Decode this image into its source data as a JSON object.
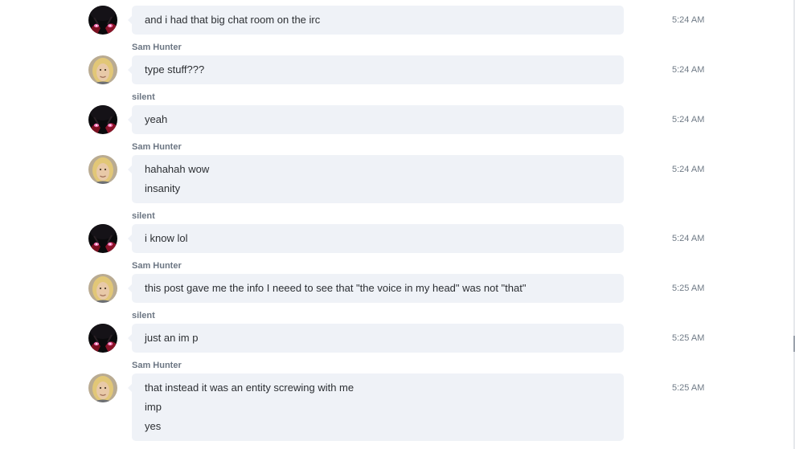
{
  "names": {
    "silent": "silent",
    "sam": "Sam Hunter"
  },
  "messages": [
    {
      "text": "and i had that big chat room on the irc",
      "time": "5:24 AM"
    },
    {
      "text": "type stuff???",
      "time": "5:24 AM"
    },
    {
      "text": "yeah",
      "time": "5:24 AM"
    },
    {
      "text": "hahahah wow",
      "text2": "insanity",
      "time": "5:24 AM"
    },
    {
      "text": "i know lol",
      "time": "5:24 AM"
    },
    {
      "text": "this post gave me the info I neeed to see that \"the voice in my head\" was not \"that\"",
      "time": "5:25 AM"
    },
    {
      "text": "just an im p",
      "time": "5:25 AM"
    },
    {
      "text": "that instead it was an entity screwing with me",
      "text2": "imp",
      "text3": "yes",
      "time": "5:25 AM"
    }
  ],
  "colors": {
    "bubble": "#eff2f7",
    "sender_name": "#6c7683",
    "timestamp": "#6f7a86",
    "message_text": "#2c2f33"
  },
  "icons": {
    "silent_avatar": "dark-anime-avatar",
    "sam_avatar": "blond-man-avatar"
  }
}
